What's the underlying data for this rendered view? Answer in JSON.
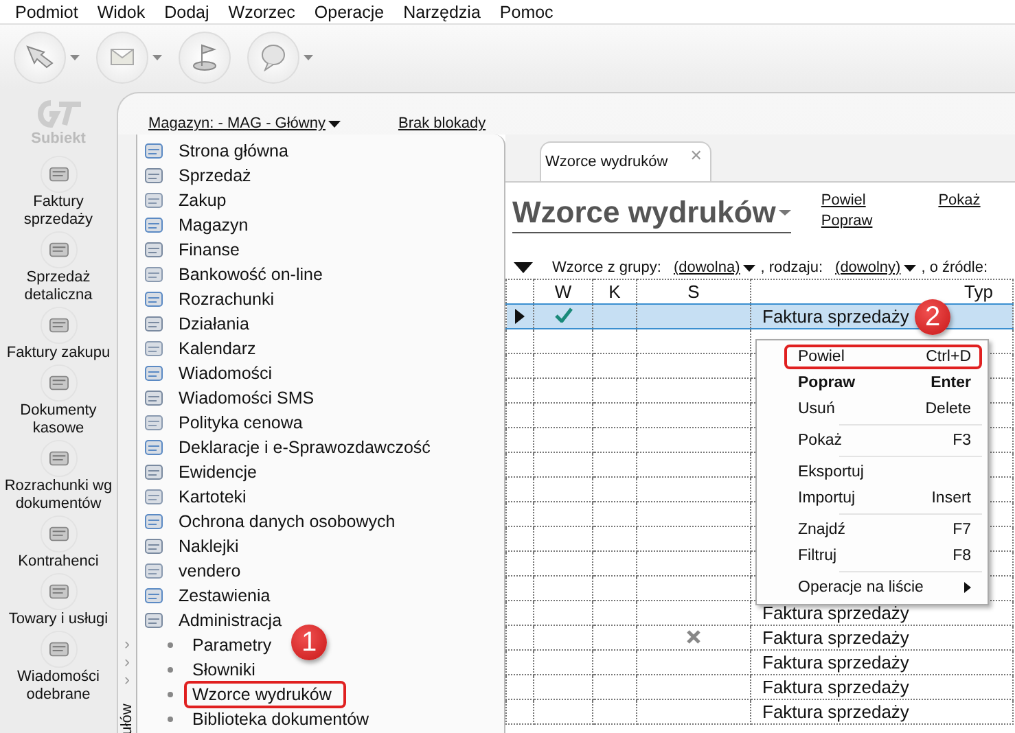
{
  "menu_bar": [
    "Podmiot",
    "Widok",
    "Dodaj",
    "Wzorzec",
    "Operacje",
    "Narzędzia",
    "Pomoc"
  ],
  "toolbar": [
    {
      "kind": "arrow",
      "dropdown": true
    },
    {
      "kind": "envelope",
      "dropdown": true
    },
    {
      "kind": "flag",
      "dropdown": false
    },
    {
      "kind": "help",
      "dropdown": true
    }
  ],
  "brand": "Subiekt",
  "sidebar": {
    "items": [
      {
        "label": "Faktury sprzedaży"
      },
      {
        "label": "Sprzedaż detaliczna"
      },
      {
        "label": "Faktury zakupu"
      },
      {
        "label": "Dokumenty kasowe"
      },
      {
        "label": "Rozrachunki wg dokumentów"
      },
      {
        "label": "Kontrahenci"
      },
      {
        "label": "Towary i usługi"
      },
      {
        "label": "Wiadomości odebrane"
      }
    ]
  },
  "header": {
    "warehouse": "Magazyn: - MAG - Główny",
    "lock": "Brak blokady"
  },
  "strip": {
    "label": "ułów",
    "chevrons": [
      "›",
      "›",
      "›"
    ]
  },
  "tree": [
    {
      "label": "Strona główna"
    },
    {
      "label": "Sprzedaż"
    },
    {
      "label": "Zakup"
    },
    {
      "label": "Magazyn"
    },
    {
      "label": "Finanse"
    },
    {
      "label": "Bankowość on-line"
    },
    {
      "label": "Rozrachunki"
    },
    {
      "label": "Działania"
    },
    {
      "label": "Kalendarz"
    },
    {
      "label": "Wiadomości"
    },
    {
      "label": "Wiadomości SMS"
    },
    {
      "label": "Polityka cenowa"
    },
    {
      "label": "Deklaracje i e-Sprawozdawczość"
    },
    {
      "label": "Ewidencje"
    },
    {
      "label": "Kartoteki"
    },
    {
      "label": "Ochrona danych osobowych"
    },
    {
      "label": "Naklejki"
    },
    {
      "label": "vendero"
    },
    {
      "label": "Zestawienia"
    },
    {
      "label": "Administracja",
      "expanded": true,
      "children": [
        {
          "label": "Parametry",
          "annotated": false
        },
        {
          "label": "Słowniki",
          "annotated": false
        },
        {
          "label": "Wzorce wydruków",
          "annotated": true
        },
        {
          "label": "Biblioteka dokumentów",
          "annotated": false
        }
      ]
    }
  ],
  "tab": {
    "label": "Wzorce wydruków",
    "close": "✕"
  },
  "title": "Wzorce wydruków",
  "actions": [
    {
      "label": "Powiel"
    },
    {
      "label": "Popraw"
    },
    {
      "label": "Pokaż"
    }
  ],
  "filter": [
    {
      "kind": "label",
      "text": "Wzorce z grupy:"
    },
    {
      "kind": "dropdown",
      "text": "(dowolna)"
    },
    {
      "kind": "label",
      "text": ", rodzaju:"
    },
    {
      "kind": "dropdown",
      "text": "(dowolny)"
    },
    {
      "kind": "label",
      "text": ", o źródle:"
    }
  ],
  "table": {
    "columns": [
      "W",
      "K",
      "S",
      "Typ"
    ],
    "rows": [
      {
        "selected": true,
        "w": true,
        "s": false,
        "typ": "Faktura sprzedaży"
      },
      {
        "selected": false,
        "w": false,
        "s": false
      },
      {
        "selected": false,
        "w": false,
        "s": false
      },
      {
        "selected": false,
        "w": false,
        "s": false
      },
      {
        "selected": false,
        "w": false,
        "s": false
      },
      {
        "selected": false,
        "w": false,
        "s": false
      },
      {
        "selected": false,
        "w": false,
        "s": false
      },
      {
        "selected": false,
        "w": false,
        "s": false
      },
      {
        "selected": false,
        "w": false,
        "s": false
      },
      {
        "selected": false,
        "w": false,
        "s": false
      },
      {
        "selected": false,
        "w": false,
        "s": false
      },
      {
        "selected": false,
        "w": false,
        "s": false
      },
      {
        "selected": false,
        "w": false,
        "s": false,
        "typ": "Faktura sprzedaży"
      },
      {
        "selected": false,
        "w": false,
        "s": true,
        "typ": "Faktura sprzedaży"
      },
      {
        "selected": false,
        "w": false,
        "s": false,
        "typ": "Faktura sprzedaży"
      },
      {
        "selected": false,
        "w": false,
        "s": false,
        "typ": "Faktura sprzedaży"
      },
      {
        "selected": false,
        "w": false,
        "s": false,
        "typ": "Faktura sprzedaży"
      }
    ]
  },
  "context_menu": [
    {
      "label": "Powiel",
      "shortcut": "Ctrl+D",
      "submenu": false,
      "bold": false,
      "annotated": true,
      "separator_before": false
    },
    {
      "label": "Popraw",
      "shortcut": "Enter",
      "submenu": false,
      "bold": true,
      "annotated": false,
      "separator_before": false
    },
    {
      "label": "Usuń",
      "shortcut": "Delete",
      "submenu": false,
      "bold": false,
      "annotated": false,
      "separator_before": false
    },
    {
      "label": "Pokaż",
      "shortcut": "F3",
      "submenu": false,
      "bold": false,
      "annotated": false,
      "separator_before": true
    },
    {
      "label": "Eksportuj",
      "submenu": false,
      "bold": false,
      "annotated": false,
      "separator_before": true
    },
    {
      "label": "Importuj",
      "shortcut": "Insert",
      "submenu": false,
      "bold": false,
      "annotated": false,
      "separator_before": false
    },
    {
      "label": "Znajdź",
      "shortcut": "F7",
      "submenu": false,
      "bold": false,
      "annotated": false,
      "separator_before": true
    },
    {
      "label": "Filtruj",
      "shortcut": "F8",
      "submenu": false,
      "bold": false,
      "annotated": false,
      "separator_before": false
    },
    {
      "label": "Operacje na liście",
      "submenu": true,
      "bold": false,
      "annotated": false,
      "separator_before": true
    }
  ],
  "step_badges": [
    "1",
    "2"
  ]
}
